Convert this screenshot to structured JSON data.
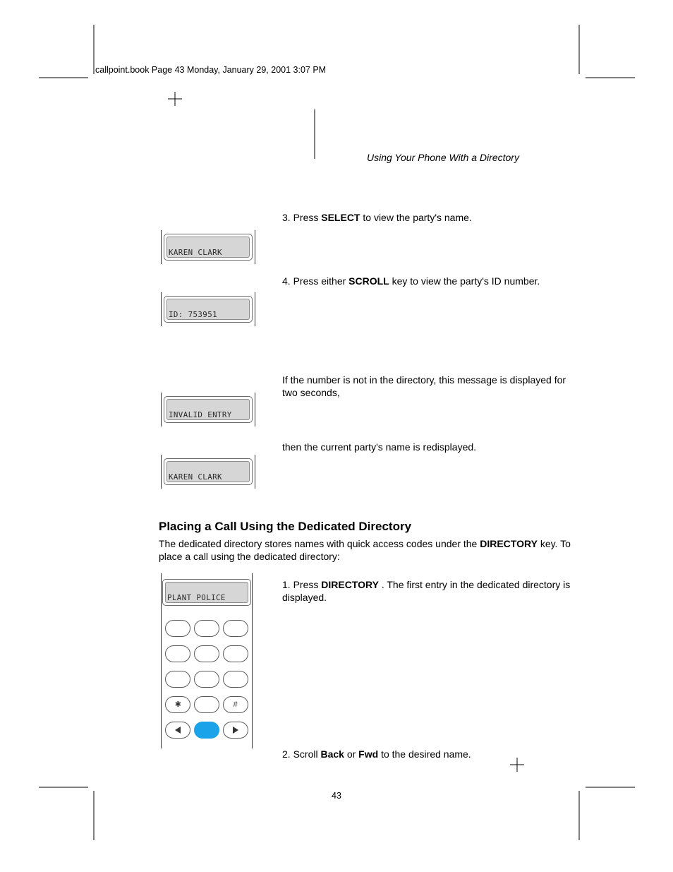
{
  "header": {
    "left": "callpoint.book  Page 43  Monday, January 29, 2001  3:07 PM",
    "right": ""
  },
  "page_title": "Using Your Phone With a Directory",
  "page_number": "43",
  "lcd1": "KAREN CLARK",
  "lcd2": "ID: 753951",
  "lcd3": "INVALID ENTRY",
  "lcd4": "KAREN CLARK",
  "lcd5": "PLANT POLICE",
  "p1_a": "3. Press ",
  "p1_key": "SELECT",
  "p1_b": " to view the party's name.",
  "p2_a": "4. Press either ",
  "p2_key": "SCROLL",
  "p2_b": " key to view the party's ID number.",
  "p3": "If the number is not in the directory, this message is displayed for two seconds,",
  "p4": "then the current party's name is redisplayed.",
  "sec_title": "Placing a Call Using the Dedicated Directory",
  "sec_body_a": "The dedicated directory stores names with quick access codes under the ",
  "sec_key1": "DIRECTORY",
  "sec_body_b": " key. To place a call using the dedicated directory:",
  "step1_a": "1. Press ",
  "step1_key": "DIRECTORY",
  "step1_b": ". The first entry in the dedicated directory is displayed.",
  "step2_a": "2. Scroll ",
  "step2_key1": "Back",
  "step2_mid": " or ",
  "step2_key2": "Fwd",
  "step2_b": " to the desired name.",
  "footer": {
    "left": "",
    "right": ""
  },
  "keys": {
    "star": "✱",
    "hash": "#"
  }
}
